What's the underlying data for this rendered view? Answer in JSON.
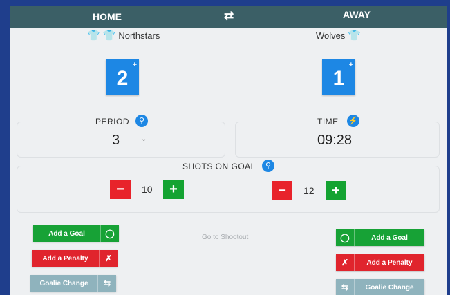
{
  "header": {
    "home_label": "HOME",
    "swap_icon": "⇄",
    "away_label": "AWAY"
  },
  "home": {
    "team_name": "Northstars",
    "score": "2",
    "score_plus": "+"
  },
  "away": {
    "team_name": "Wolves",
    "score": "1",
    "score_plus": "+"
  },
  "period": {
    "label": "PERIOD",
    "value": "3",
    "chevron": "⌄"
  },
  "time": {
    "label": "TIME",
    "value": "09:28"
  },
  "shots": {
    "label": "SHOTS ON GOAL",
    "home_value": "10",
    "away_value": "12",
    "minus": "−",
    "plus": "+"
  },
  "actions": {
    "add_goal": "Add a Goal",
    "add_penalty": "Add a Penalty",
    "goalie_change": "Goalie Change",
    "shootout": "Go to Shootout"
  },
  "colors": {
    "header": "#3b5f66",
    "accent": "#1d87e4",
    "green": "#17a236",
    "red": "#e0242d",
    "gray": "#8fb3bd"
  }
}
